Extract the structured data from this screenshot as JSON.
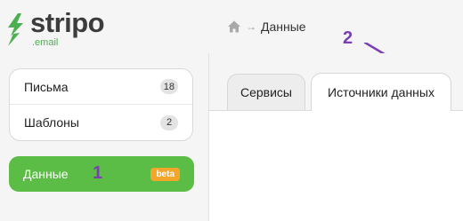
{
  "brand": {
    "name": "stripo",
    "sub": ".email",
    "logo_color": "#4caf50"
  },
  "breadcrumb": {
    "home_icon": "home-icon",
    "separator": "→",
    "current": "Данные"
  },
  "sidebar": {
    "items": [
      {
        "label": "Письма",
        "count": "18"
      },
      {
        "label": "Шаблоны",
        "count": "2"
      }
    ],
    "active": {
      "label": "Данные",
      "badge": "beta"
    }
  },
  "tabs": [
    {
      "label": "Сервисы",
      "active": false
    },
    {
      "label": "Источники данных",
      "active": true
    }
  ],
  "annotations": {
    "one": "1",
    "two": "2",
    "color": "#7a3fb0"
  },
  "colors": {
    "accent": "#5bbd45",
    "beta": "#f4a62a",
    "background": "#f5f5f5"
  }
}
